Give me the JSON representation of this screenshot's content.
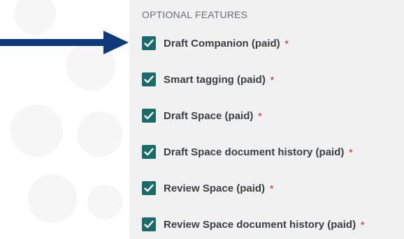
{
  "section": {
    "title": "OPTIONAL FEATURES"
  },
  "features": [
    {
      "label": "Draft Companion (paid)",
      "checked": true,
      "required_marker": "*"
    },
    {
      "label": "Smart tagging (paid)",
      "checked": true,
      "required_marker": "*"
    },
    {
      "label": "Draft Space (paid)",
      "checked": true,
      "required_marker": "*"
    },
    {
      "label": "Draft Space document history (paid)",
      "checked": true,
      "required_marker": "*"
    },
    {
      "label": "Review Space (paid)",
      "checked": true,
      "required_marker": "*"
    },
    {
      "label": "Review Space document history (paid)",
      "checked": true,
      "required_marker": "*"
    }
  ],
  "colors": {
    "checkbox": "#1c6b6b",
    "required": "#d04848",
    "arrow": "#0f3a7a",
    "panel": "#f1f1f2"
  },
  "icons": {
    "checkmark": "check-icon",
    "pointer": "arrow-right-icon"
  }
}
